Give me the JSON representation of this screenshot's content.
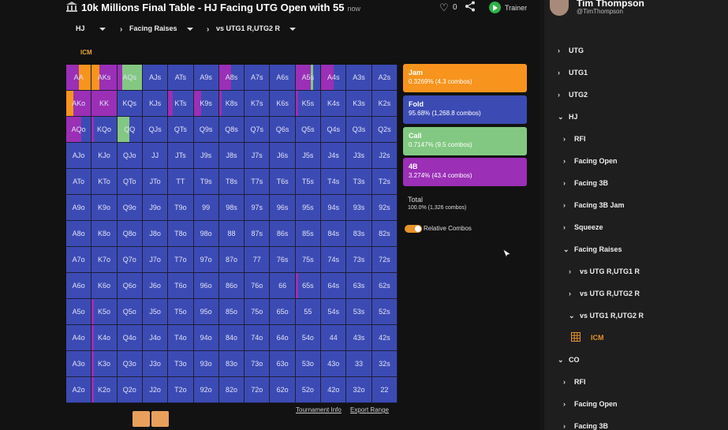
{
  "header": {
    "title": "10k Millions Final Table - HJ Facing UTG Open with 55",
    "time": "now",
    "likes": "0",
    "trainer_label": "Trainer",
    "icon_logo": "bank-icon",
    "icon_heart": "heart-icon",
    "icon_share": "share-icon"
  },
  "filters": {
    "position": "HJ",
    "action": "Facing Raises",
    "versus": "vs UTG1 R,UTG2 R"
  },
  "icm_tag": "ICM",
  "grid": {
    "colors": {
      "fold": "#3c4bb4",
      "jam": "#f7941d",
      "call": "#82c882",
      "fourbet": "#9b2fb6"
    },
    "hands": [
      [
        "AA",
        "AKs",
        "AQs",
        "AJs",
        "ATs",
        "A9s",
        "A8s",
        "A7s",
        "A6s",
        "A5s",
        "A4s",
        "A3s",
        "A2s"
      ],
      [
        "AKo",
        "KK",
        "KQs",
        "KJs",
        "KTs",
        "K9s",
        "K8s",
        "K7s",
        "K6s",
        "K5s",
        "K4s",
        "K3s",
        "K2s"
      ],
      [
        "AQo",
        "KQo",
        "QQ",
        "QJs",
        "QTs",
        "Q9s",
        "Q8s",
        "Q7s",
        "Q6s",
        "Q5s",
        "Q4s",
        "Q3s",
        "Q2s"
      ],
      [
        "AJo",
        "KJo",
        "QJo",
        "JJ",
        "JTs",
        "J9s",
        "J8s",
        "J7s",
        "J6s",
        "J5s",
        "J4s",
        "J3s",
        "J2s"
      ],
      [
        "ATo",
        "KTo",
        "QTo",
        "JTo",
        "TT",
        "T9s",
        "T8s",
        "T7s",
        "T6s",
        "T5s",
        "T4s",
        "T3s",
        "T2s"
      ],
      [
        "A9o",
        "K9o",
        "Q9o",
        "J9o",
        "T9o",
        "99",
        "98s",
        "97s",
        "96s",
        "95s",
        "94s",
        "93s",
        "92s"
      ],
      [
        "A8o",
        "K8o",
        "Q8o",
        "J8o",
        "T8o",
        "98o",
        "88",
        "87s",
        "86s",
        "85s",
        "84s",
        "83s",
        "82s"
      ],
      [
        "A7o",
        "K7o",
        "Q7o",
        "J7o",
        "T7o",
        "97o",
        "87o",
        "77",
        "76s",
        "75s",
        "74s",
        "73s",
        "72s"
      ],
      [
        "A6o",
        "K6o",
        "Q6o",
        "J6o",
        "T6o",
        "96o",
        "86o",
        "76o",
        "66",
        "65s",
        "64s",
        "63s",
        "62s"
      ],
      [
        "A5o",
        "K5o",
        "Q5o",
        "J5o",
        "T5o",
        "95o",
        "85o",
        "75o",
        "65o",
        "55",
        "54s",
        "53s",
        "52s"
      ],
      [
        "A4o",
        "K4o",
        "Q4o",
        "J4o",
        "T4o",
        "94o",
        "84o",
        "74o",
        "64o",
        "54o",
        "44",
        "43s",
        "42s"
      ],
      [
        "A3o",
        "K3o",
        "Q3o",
        "J3o",
        "T3o",
        "93o",
        "83o",
        "73o",
        "63o",
        "53o",
        "43o",
        "33",
        "32s"
      ],
      [
        "A2o",
        "K2o",
        "Q2o",
        "J2o",
        "T2o",
        "92o",
        "82o",
        "72o",
        "62o",
        "52o",
        "42o",
        "32o",
        "22"
      ]
    ],
    "mixes": {
      "AA": [
        {
          "a": "fourbet",
          "f": 0.5
        },
        {
          "a": "jam",
          "f": 0.5
        }
      ],
      "AKs": [
        {
          "a": "jam",
          "f": 0.3
        },
        {
          "a": "fourbet",
          "f": 0.7
        }
      ],
      "AQs": [
        {
          "a": "fourbet",
          "f": 0.2
        },
        {
          "a": "call",
          "f": 0.8
        }
      ],
      "AKo": [
        {
          "a": "jam",
          "f": 0.3
        },
        {
          "a": "fourbet",
          "f": 0.7
        }
      ],
      "KK": [
        {
          "a": "fourbet",
          "f": 1.0
        }
      ],
      "QQ": [
        {
          "a": "call",
          "f": 0.5
        },
        {
          "a": "fold",
          "f": 0.5
        }
      ],
      "AQo": [
        {
          "a": "fourbet",
          "f": 0.6
        },
        {
          "a": "fold",
          "f": 0.4
        }
      ],
      "A8s": [
        {
          "a": "fourbet",
          "f": 0.5
        },
        {
          "a": "fold",
          "f": 0.5
        }
      ],
      "A5s": [
        {
          "a": "fourbet",
          "f": 0.6
        },
        {
          "a": "call",
          "f": 0.1
        },
        {
          "a": "fold",
          "f": 0.3
        }
      ],
      "A4s": [
        {
          "a": "fourbet",
          "f": 0.5
        },
        {
          "a": "fold",
          "f": 0.5
        }
      ],
      "K9s": [
        {
          "a": "fourbet",
          "f": 0.3
        },
        {
          "a": "fold",
          "f": 0.7
        }
      ],
      "KTs": [
        {
          "a": "fourbet",
          "f": 0.2
        },
        {
          "a": "fold",
          "f": 0.8
        }
      ],
      "K8s": [
        {
          "a": "fourbet",
          "f": 0.1
        },
        {
          "a": "fold",
          "f": 0.9
        }
      ],
      "K5s": [
        {
          "a": "fourbet",
          "f": 0.1
        },
        {
          "a": "fold",
          "f": 0.9
        }
      ],
      "KQo": [
        {
          "a": "fourbet",
          "f": 0.1
        },
        {
          "a": "fold",
          "f": 0.9
        }
      ],
      "65s": [
        {
          "a": "fourbet",
          "f": 0.1
        },
        {
          "a": "fold",
          "f": 0.9
        }
      ],
      "K5o": [
        {
          "a": "fourbet",
          "f": 0.1
        },
        {
          "a": "fold",
          "f": 0.9
        }
      ],
      "K4o": [
        {
          "a": "fourbet",
          "f": 0.1
        },
        {
          "a": "fold",
          "f": 0.9
        }
      ],
      "K3o": [
        {
          "a": "fourbet",
          "f": 0.1
        },
        {
          "a": "fold",
          "f": 0.9
        }
      ],
      "K2o": [
        {
          "a": "fourbet",
          "f": 0.1
        },
        {
          "a": "fold",
          "f": 0.9
        }
      ]
    }
  },
  "legend": [
    {
      "key": "jam",
      "label": "Jam",
      "value": "0.3269% (4.3 combos)",
      "color": "#f7941d"
    },
    {
      "key": "fold",
      "label": "Fold",
      "value": "95.68% (1,268.8 combos)",
      "color": "#3c4bb4"
    },
    {
      "key": "call",
      "label": "Call",
      "value": "0.7147% (9.5 combos)",
      "color": "#82c882"
    },
    {
      "key": "fourbet",
      "label": "4B",
      "value": "3.274% (43.4 combos)",
      "color": "#9b2fb6"
    }
  ],
  "total": {
    "label": "Total",
    "value": "100.0% (1,326 combos)"
  },
  "relative_combos_label": "Relative Combos",
  "links": {
    "tournament_info": "Tournament Info",
    "export_range": "Export Range"
  },
  "sidebar": {
    "user_name": "Tim Thompson",
    "user_handle": "@TimThompson",
    "items": [
      {
        "label": "UTG",
        "level": 0,
        "open": false
      },
      {
        "label": "UTG1",
        "level": 0,
        "open": false
      },
      {
        "label": "UTG2",
        "level": 0,
        "open": false
      },
      {
        "label": "HJ",
        "level": 0,
        "open": true
      },
      {
        "label": "RFI",
        "level": 1,
        "open": false
      },
      {
        "label": "Facing Open",
        "level": 1,
        "open": false
      },
      {
        "label": "Facing 3B",
        "level": 1,
        "open": false
      },
      {
        "label": "Facing 3B Jam",
        "level": 1,
        "open": false
      },
      {
        "label": "Squeeze",
        "level": 1,
        "open": false
      },
      {
        "label": "Facing Raises",
        "level": 1,
        "open": true
      },
      {
        "label": "vs UTG R,UTG1 R",
        "level": 2,
        "open": false
      },
      {
        "label": "vs UTG R,UTG2 R",
        "level": 2,
        "open": false
      },
      {
        "label": "vs UTG1 R,UTG2 R",
        "level": 2,
        "open": true
      },
      {
        "label": "ICM",
        "level": 3,
        "open": false,
        "leaf": true
      },
      {
        "label": "CO",
        "level": 0,
        "open": true
      },
      {
        "label": "RFI",
        "level": 1,
        "open": false
      },
      {
        "label": "Facing Open",
        "level": 1,
        "open": false
      },
      {
        "label": "Facing 3B",
        "level": 1,
        "open": false
      }
    ]
  }
}
